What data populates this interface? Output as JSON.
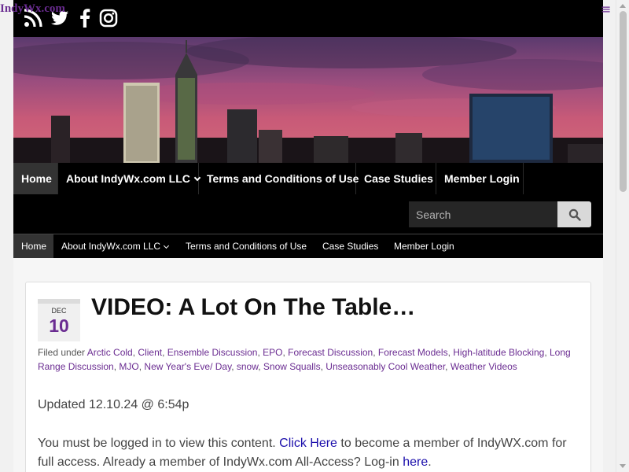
{
  "site_title": "IndyWx.com",
  "menu_glyph": "≡",
  "social_icons": [
    "rss-icon",
    "twitter-icon",
    "facebook-icon",
    "instagram-icon"
  ],
  "colors": {
    "brand": "#6a2c91",
    "nav_bg": "#000000",
    "link": "#1a0dab"
  },
  "main_nav": {
    "items": [
      {
        "label": "Home",
        "active": true
      },
      {
        "label": "About IndyWx.com LLC",
        "dropdown": true
      },
      {
        "label": "Terms and Conditions of Use"
      },
      {
        "label": "Case Studies"
      },
      {
        "label": "Member Login"
      }
    ],
    "search_placeholder": "Search"
  },
  "sub_nav": {
    "items": [
      {
        "label": "Home",
        "active": true
      },
      {
        "label": "About IndyWx.com LLC",
        "dropdown": true
      },
      {
        "label": "Terms and Conditions of Use"
      },
      {
        "label": "Case Studies"
      },
      {
        "label": "Member Login"
      }
    ]
  },
  "post": {
    "date_month": "DEC",
    "date_day": "10",
    "title": "VIDEO: A Lot On The Table…",
    "filed_under": "Filed under",
    "categories": [
      "Arctic Cold",
      "Client",
      "Ensemble Discussion",
      "EPO",
      "Forecast Discussion",
      "Forecast Models",
      "High-latitude Blocking",
      "Long Range Discussion",
      "MJO",
      "New Year's Eve/ Day",
      "snow",
      "Snow Squalls",
      "Unseasonably Cool Weather",
      "Weather Videos"
    ],
    "updated": "Updated 12.10.24 @ 6:54p",
    "body_part1": "You must be logged in to view this content. ",
    "click_here": "Click Here",
    "body_part2": " to become a member of IndyWX.com for full access.  Already a member of IndyWx.com All-Access?  Log-in ",
    "here_link": "here",
    "body_end": "."
  }
}
